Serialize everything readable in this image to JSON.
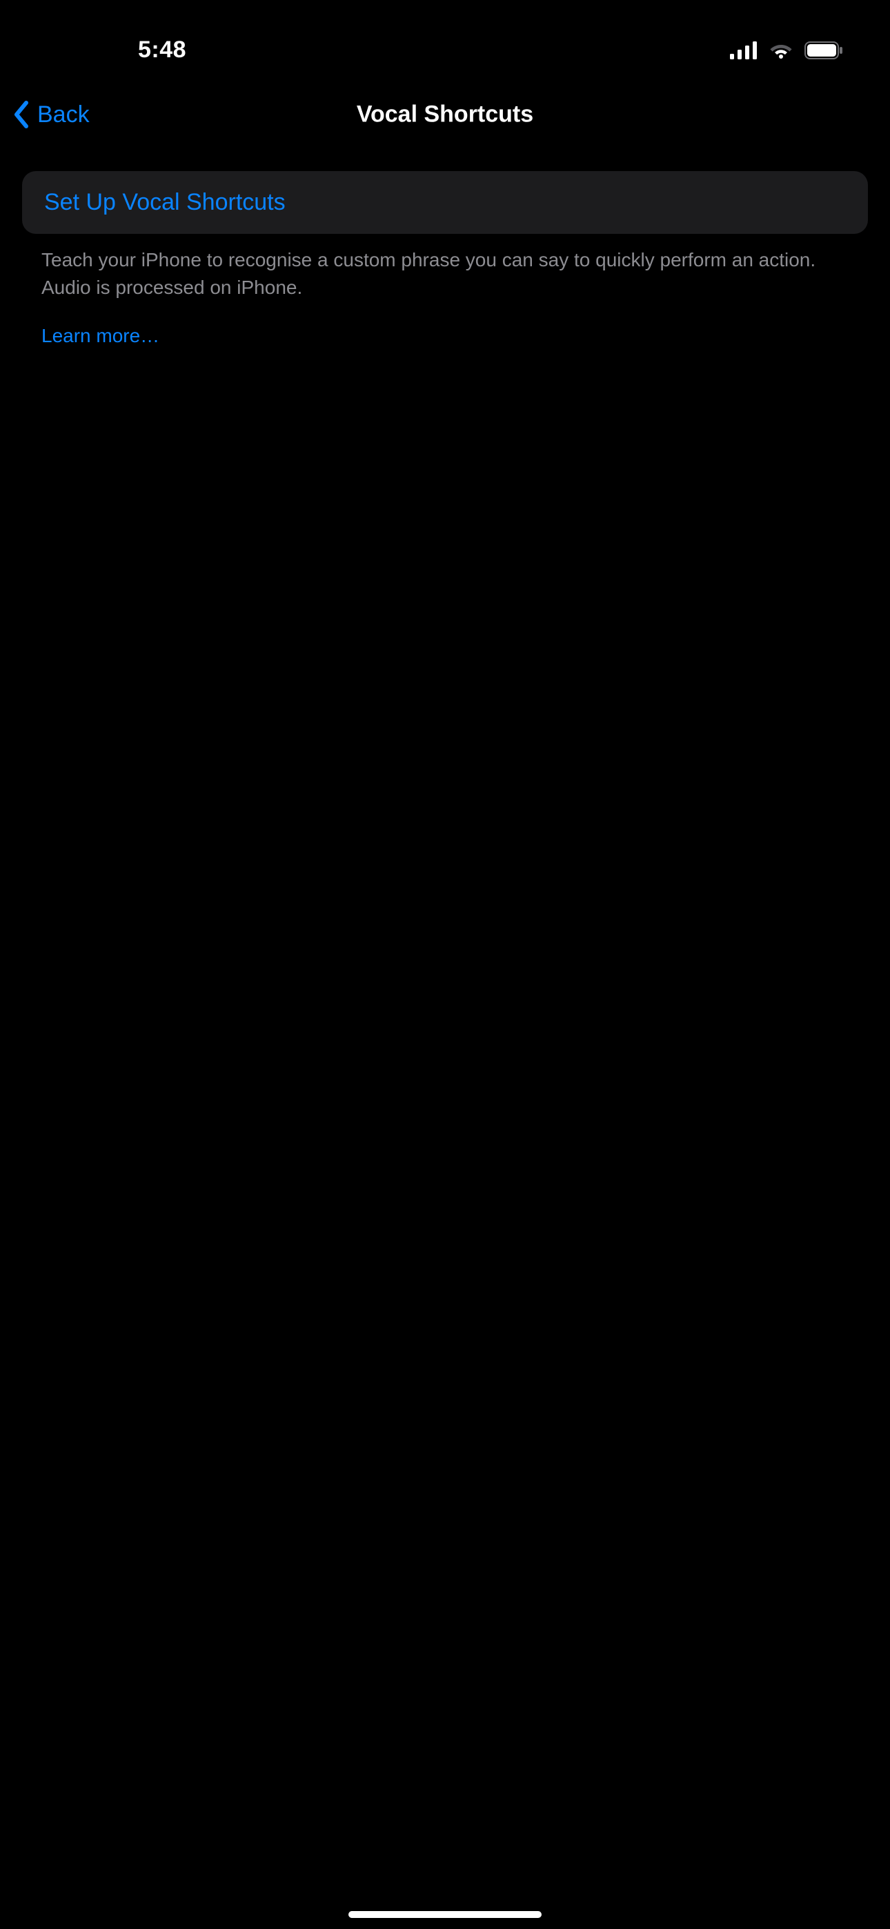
{
  "statusBar": {
    "time": "5:48"
  },
  "nav": {
    "backLabel": "Back",
    "title": "Vocal Shortcuts"
  },
  "main": {
    "setupLabel": "Set Up Vocal Shortcuts",
    "description": "Teach your iPhone to recognise a custom phrase you can say to quickly perform an action. Audio is processed on iPhone.",
    "learnMore": "Learn more…"
  }
}
